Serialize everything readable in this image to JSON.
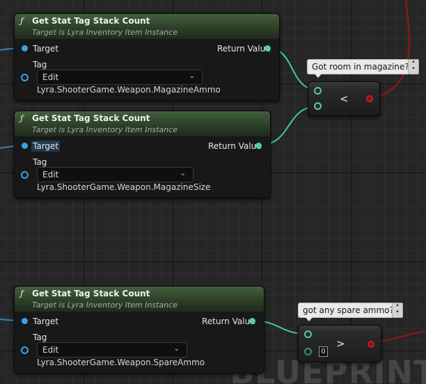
{
  "nodes": [
    {
      "title": "Get Stat Tag Stack Count",
      "subtitle": "Target is Lyra Inventory Item Instance",
      "target_label": "Target",
      "return_label": "Return Value",
      "tag_label": "Tag",
      "edit_label": "Edit",
      "tag_value": "Lyra.ShooterGame.Weapon.MagazineAmmo"
    },
    {
      "title": "Get Stat Tag Stack Count",
      "subtitle": "Target is Lyra Inventory Item Instance",
      "target_label": "Target",
      "return_label": "Return Value",
      "tag_label": "Tag",
      "edit_label": "Edit",
      "tag_value": "Lyra.ShooterGame.Weapon.MagazineSize"
    },
    {
      "title": "Get Stat Tag Stack Count",
      "subtitle": "Target is Lyra Inventory Item Instance",
      "target_label": "Target",
      "return_label": "Return Value",
      "tag_label": "Tag",
      "edit_label": "Edit",
      "tag_value": "Lyra.ShooterGame.Weapon.SpareAmmo"
    }
  ],
  "compare_nodes": [
    {
      "operator": "<",
      "comment": "Got room in magazine?"
    },
    {
      "operator": ">",
      "comment": "got any spare ammo?",
      "literal_value": "0"
    }
  ],
  "function_icon": "ƒ",
  "chevron_glyph": "⌄",
  "watermark": "BLUEPRINT",
  "colors": {
    "header_green": "#2d4029",
    "exec_pin": "#3aa3e8",
    "float_pin": "#4fd1a1",
    "bool_wire": "#a01818",
    "background": "#262626"
  }
}
